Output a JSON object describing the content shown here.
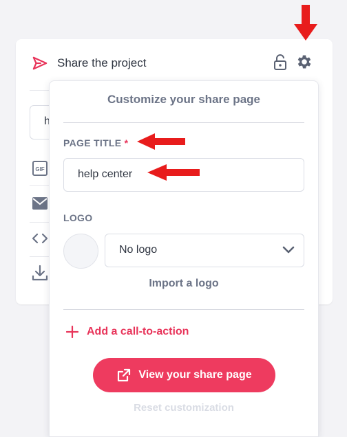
{
  "card": {
    "title": "Share the project",
    "input_value": "h"
  },
  "panel": {
    "title": "Customize your share page",
    "page_title_label": "PAGE TITLE",
    "required_mark": "*",
    "page_title_value": "help center",
    "logo_label": "LOGO",
    "logo_select_value": "No logo",
    "import_logo": "Import a logo",
    "add_cta": "Add a call-to-action",
    "view_button": "View your share page",
    "reset": "Reset customization"
  },
  "side_icons": [
    "gif-icon",
    "mail-icon",
    "code-icon",
    "download-icon"
  ],
  "colors": {
    "accent": "#ee3b5f",
    "annotation_arrow": "#e81c1c",
    "muted_text": "#6c7487",
    "background": "#f3f3f6"
  }
}
